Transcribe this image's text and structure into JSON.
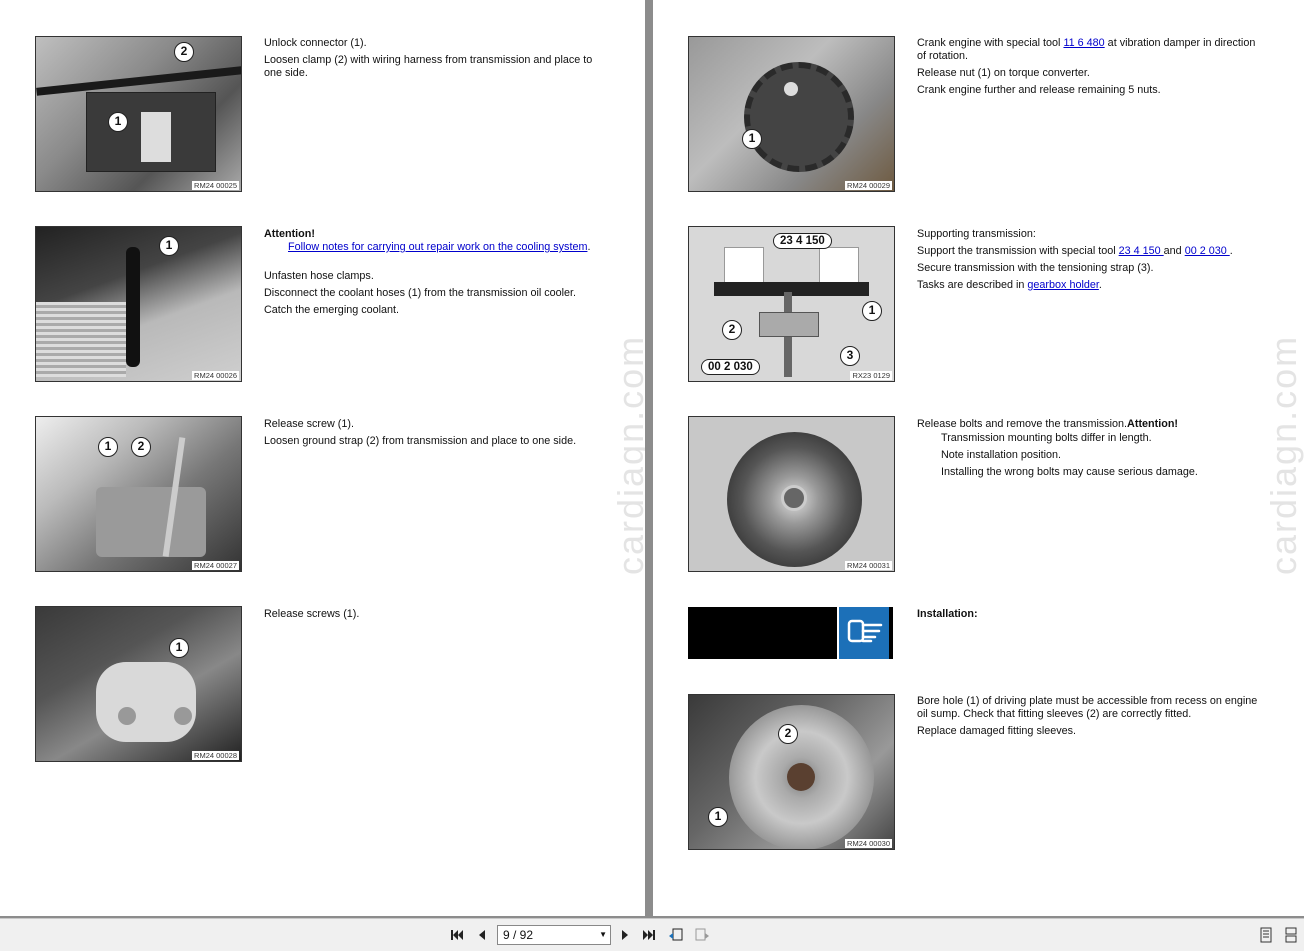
{
  "viewer": {
    "page_indicator": "9 / 92",
    "watermark": "cardiagn.com"
  },
  "left_page": {
    "steps": [
      {
        "image_code": "RM24 00025",
        "callouts": [
          "1",
          "2"
        ],
        "lines": [
          "Unlock connector (1).",
          "Loosen clamp (2) with wiring harness from transmission and place to one side."
        ]
      },
      {
        "image_code": "RM24 00026",
        "callouts": [
          "1"
        ],
        "attention": "Attention!",
        "link": "Follow notes for carrying out repair work on the cooling system",
        "link_suffix": ".",
        "lines": [
          "Unfasten hose clamps.",
          "Disconnect the coolant hoses (1) from the transmission oil cooler.",
          "Catch the emerging coolant."
        ]
      },
      {
        "image_code": "RM24 00027",
        "callouts": [
          "1",
          "2"
        ],
        "lines": [
          "Release screw (1).",
          "Loosen ground strap (2) from transmission and place to one side."
        ]
      },
      {
        "image_code": "RM24 00028",
        "callouts": [
          "1"
        ],
        "lines": [
          "Release screws (1)."
        ]
      }
    ]
  },
  "right_page": {
    "step1": {
      "image_code": "RM24 00029",
      "callout": "1",
      "line1_pre": "Crank engine with special tool ",
      "line1_link": "11 6 480",
      "line1_post": " at vibration damper in direction of rotation.",
      "line2": "Release nut (1) on torque converter.",
      "line3": "Crank engine further and release remaining 5 nuts."
    },
    "step2": {
      "image_code": "RX23 0129",
      "tool_label_top": "23 4 150",
      "tool_label_bottom": "00 2 030",
      "callouts": [
        "1",
        "2",
        "3"
      ],
      "line1": "Supporting transmission:",
      "line2_pre": "Support the transmission with special tool ",
      "line2_link1": "23 4 150 ",
      "line2_mid": "and ",
      "line2_link2": "00 2 030 ",
      "line2_post": ".",
      "line3": "Secure transmission with the tensioning strap (3).",
      "line4_pre": "Tasks are described in ",
      "line4_link": "gearbox holder",
      "line4_post": "."
    },
    "step3": {
      "image_code": "RM24 00031",
      "line1": "Release bolts and remove the transmission.",
      "attention": "Attention!",
      "notes": [
        "Transmission mounting bolts differ in length.",
        "Note installation position.",
        "Installing the wrong bolts may cause serious damage."
      ]
    },
    "installation": {
      "heading": "Installation:",
      "icon": "hand-pointing-icon"
    },
    "step4": {
      "image_code": "RM24 00030",
      "callouts": [
        "1",
        "2"
      ],
      "line1": "Bore hole (1) of driving plate must be accessible from recess on engine oil sump. Check that fitting sleeves (2) are correctly fitted.",
      "line2": "Replace damaged fitting sleeves."
    }
  },
  "colors": {
    "link": "#0000cc",
    "info_icon_bg": "#1c70b8"
  }
}
